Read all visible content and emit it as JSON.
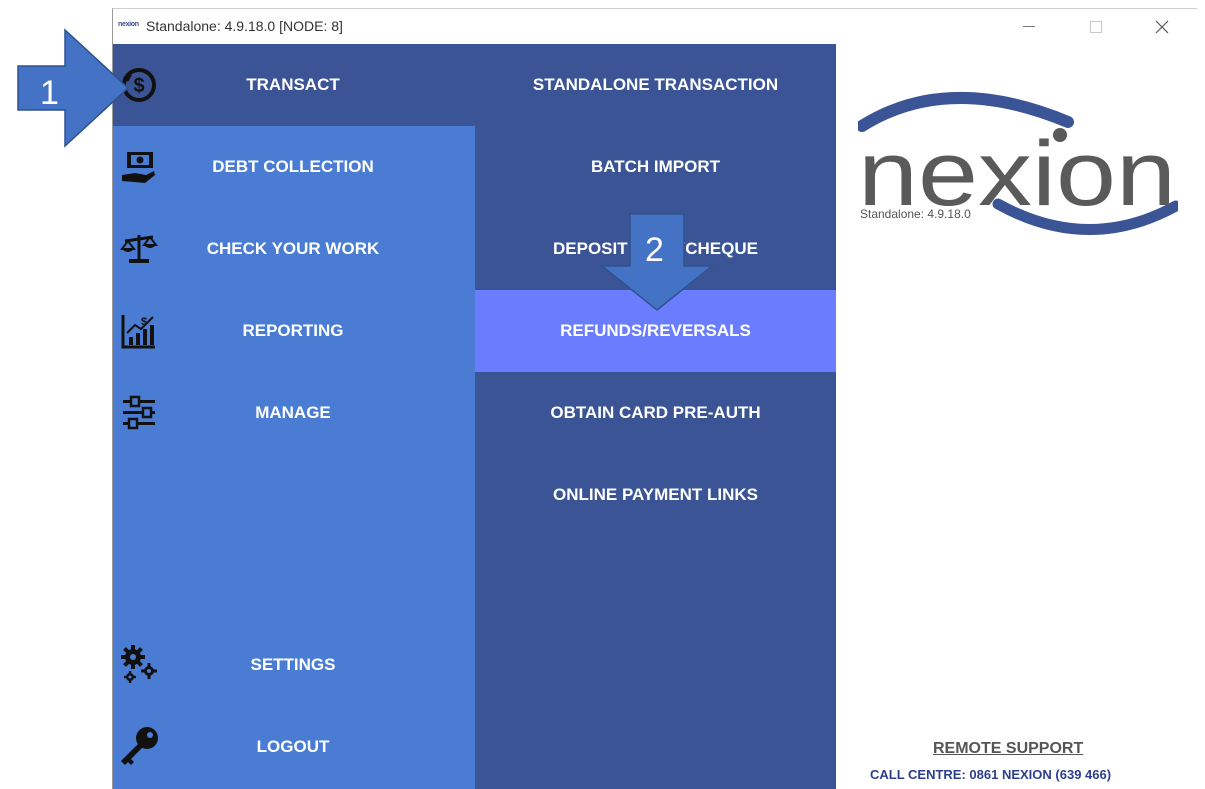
{
  "window": {
    "title": "Standalone: 4.9.18.0 [NODE: 8]",
    "title_logo": "nexion"
  },
  "left_menu": {
    "items": [
      {
        "label": "TRANSACT",
        "icon": "dollar-cycle-icon",
        "active": true
      },
      {
        "label": "DEBT COLLECTION",
        "icon": "hand-cash-icon"
      },
      {
        "label": "CHECK YOUR WORK",
        "icon": "scales-icon"
      },
      {
        "label": "REPORTING",
        "icon": "chart-growth-icon"
      },
      {
        "label": "MANAGE",
        "icon": "sliders-icon"
      },
      {
        "label": "SETTINGS",
        "icon": "gears-icon"
      },
      {
        "label": "LOGOUT",
        "icon": "key-icon"
      }
    ]
  },
  "sub_menu": {
    "items": [
      {
        "label": "STANDALONE TRANSACTION"
      },
      {
        "label": "BATCH IMPORT"
      },
      {
        "label": "DEPOSIT CASH/CHEQUE"
      },
      {
        "label": "REFUNDS/REVERSALS",
        "selected": true
      },
      {
        "label": "OBTAIN CARD PRE-AUTH"
      },
      {
        "label": "ONLINE PAYMENT LINKS"
      }
    ]
  },
  "brand": {
    "logo_text": "nexion",
    "version": "Standalone: 4.9.18.0"
  },
  "footer": {
    "remote_support": "REMOTE SUPPORT",
    "call_centre": "CALL CENTRE: 0861 NEXION (639 466)"
  },
  "annotations": {
    "step1": "1",
    "step2": "2"
  },
  "colors": {
    "left_menu_bg": "#4a7cd4",
    "active_bg": "#3a5495",
    "sub_menu_bg": "#3a5495",
    "selected_bg": "#6b7dff",
    "brand_blue": "#3a5495",
    "brand_grey": "#5a5a5a",
    "annotation_blue": "#4472c4"
  }
}
